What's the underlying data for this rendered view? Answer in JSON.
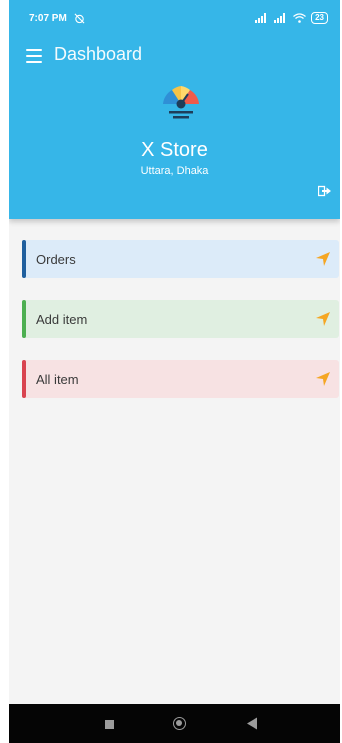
{
  "status_bar": {
    "time": "7:07 PM",
    "battery": "23"
  },
  "app_bar": {
    "title": "Dashboard"
  },
  "store": {
    "name": "X Store",
    "location": "Uttara, Dhaka"
  },
  "menu": [
    {
      "label": "Orders",
      "accent": "#1f5f9e",
      "background": "#dcebf9"
    },
    {
      "label": "Add item",
      "accent": "#4caf50",
      "background": "#e0efe1"
    },
    {
      "label": "All item",
      "accent": "#d9434f",
      "background": "#f7e2e3"
    }
  ],
  "colors": {
    "header": "#36b6e8",
    "arrow": "#f5a623"
  }
}
